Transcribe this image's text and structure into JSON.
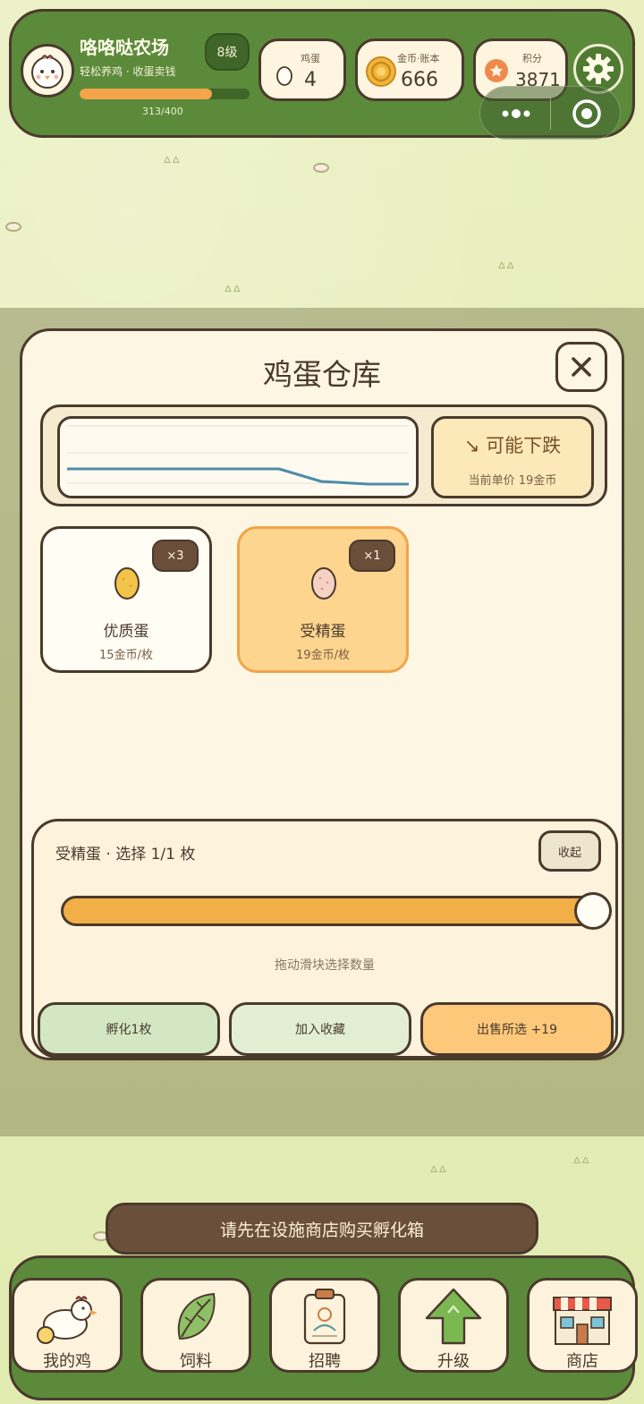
{
  "header": {
    "farm_name": "咯咯哒农场",
    "farm_subtitle": "轻松养鸡 · 收蛋卖钱",
    "level": "8级",
    "xp_text": "313/400",
    "xp_progress": 0.78,
    "stats": [
      {
        "caption": "鸡蛋",
        "value": "4",
        "icon": "egg-icon"
      },
      {
        "caption": "金币·账本",
        "value": "666",
        "icon": "coin-icon"
      },
      {
        "caption": "积分",
        "value": "3871",
        "icon": "star-badge-icon"
      }
    ]
  },
  "modal": {
    "title": "鸡蛋仓库",
    "trend": {
      "label": "↘ 可能下跌",
      "price": "当前单价 19金币"
    },
    "eggs": [
      {
        "badge": "×3",
        "name": "优质蛋",
        "price": "15金币/枚",
        "selected": false,
        "color": "#f3c34a"
      },
      {
        "badge": "×1",
        "name": "受精蛋",
        "price": "19金币/枚",
        "selected": true,
        "color": "#f6d2c4"
      }
    ],
    "panel": {
      "title": "受精蛋 · 选择 1/1 枚",
      "collapse_label": "收起",
      "slider_fraction": 1.0,
      "hint": "拖动滑块选择数量",
      "actions": [
        {
          "label": "孵化1枚",
          "color": "#d3e7c4"
        },
        {
          "label": "加入收藏",
          "color": "#e2efd3"
        },
        {
          "label": "出售所选 +19",
          "color": "#fdc87a"
        }
      ]
    }
  },
  "toast": "请先在设施商店购买孵化箱",
  "nav": [
    {
      "label": "我的鸡",
      "icon": "hen-icon"
    },
    {
      "label": "饲料",
      "icon": "leaf-icon"
    },
    {
      "label": "招聘",
      "icon": "id-badge-icon"
    },
    {
      "label": "升级",
      "icon": "up-arrow-icon"
    },
    {
      "label": "商店",
      "icon": "shop-icon"
    }
  ],
  "colors": {
    "green": "#5c8a3b",
    "cream": "#fdf6e2",
    "orange": "#f2ae47",
    "chart_line": "#4e8ca8"
  }
}
